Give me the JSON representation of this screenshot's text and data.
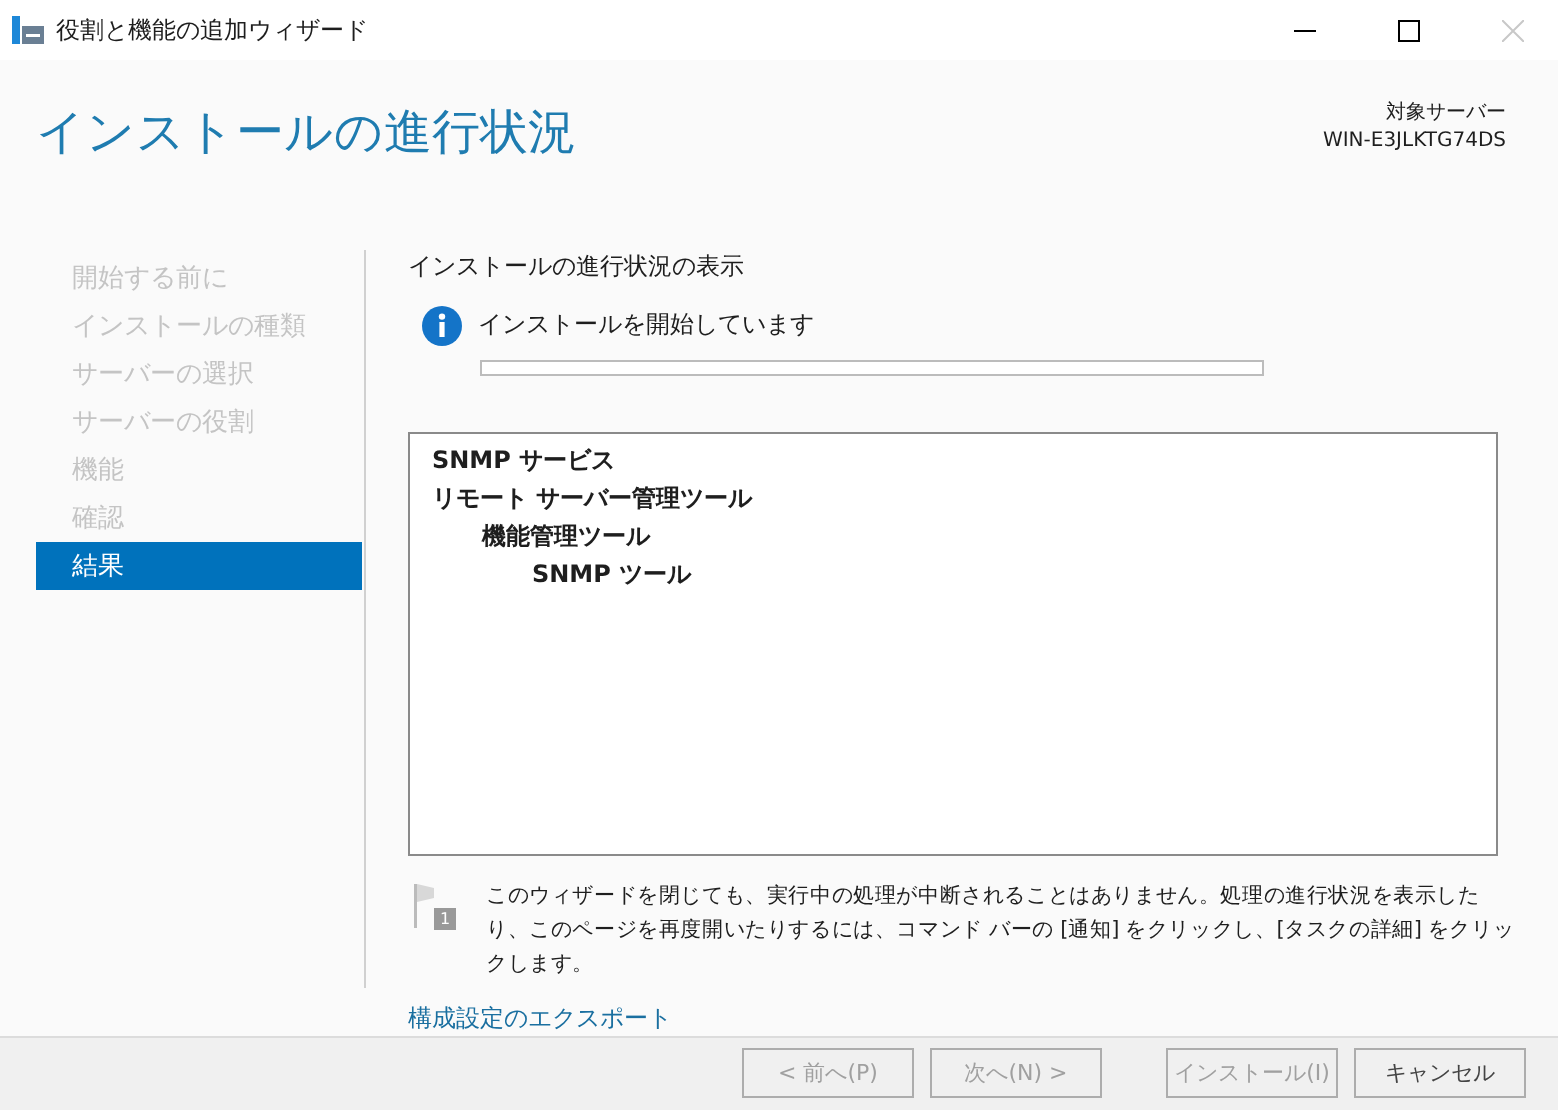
{
  "window": {
    "title": "役割と機能の追加ウィザード",
    "close_disabled": true
  },
  "header": {
    "title": "インストールの進行状況",
    "target_label": "対象サーバー",
    "target_server": "WIN-E3JLKTG74DS"
  },
  "sidebar": {
    "items": [
      {
        "label": "開始する前に",
        "selected": false
      },
      {
        "label": "インストールの種類",
        "selected": false
      },
      {
        "label": "サーバーの選択",
        "selected": false
      },
      {
        "label": "サーバーの役割",
        "selected": false
      },
      {
        "label": "機能",
        "selected": false
      },
      {
        "label": "確認",
        "selected": false
      },
      {
        "label": "結果",
        "selected": true
      }
    ]
  },
  "content": {
    "heading": "インストールの進行状況の表示",
    "status": "インストールを開始しています",
    "progress": {
      "level": 0
    },
    "features": [
      {
        "label": "SNMP サービス"
      },
      {
        "label": "リモート サーバー管理ツール",
        "children": [
          {
            "label": "機能管理ツール",
            "children": [
              {
                "label": "SNMP ツール"
              }
            ]
          }
        ]
      }
    ],
    "notice_badge": "1",
    "notice": "このウィザードを閉じても、実行中の処理が中断されることはありません。処理の進行状況を表示したり、このページを再度開いたりするには、コマンド バーの [通知] をクリックし、[タスクの詳細] をクリックします。",
    "export_link": "構成設定のエクスポート"
  },
  "buttons": [
    {
      "label": "< 前へ(P)",
      "disabled": true
    },
    {
      "label": "次へ(N) >",
      "disabled": true
    },
    {
      "label": "インストール(I)",
      "disabled": true
    },
    {
      "label": "キャンセル",
      "disabled": false
    }
  ]
}
